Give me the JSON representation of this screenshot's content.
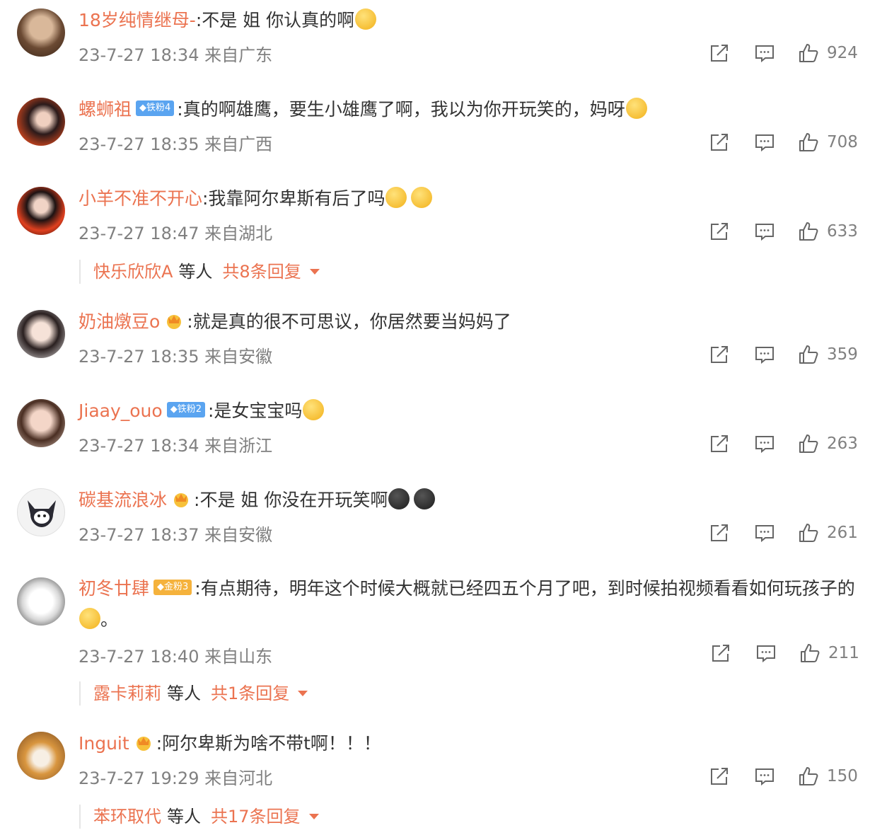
{
  "comments": [
    {
      "nick": "18岁纯情继母-",
      "badge": "",
      "text": ":不是 姐 你认真的啊",
      "time": "23-7-27 18:34 来自广东",
      "likes": "924"
    },
    {
      "nick": "螺蛳祖",
      "badge": "铁粉4",
      "text": ":真的啊雄鹰，要生小雄鹰了啊，我以为你开玩笑的，妈呀",
      "time": "23-7-27 18:35 来自广西",
      "likes": "708"
    },
    {
      "nick": "小羊不准不开心",
      "badge": "",
      "text": ":我靠阿尔卑斯有后了吗",
      "time": "23-7-27 18:47 来自湖北",
      "likes": "633"
    },
    {
      "nick": "奶油燉豆o",
      "badge": "",
      "text": ":就是真的很不可思议，你居然要当妈妈了",
      "time": "23-7-27 18:35 来自安徽",
      "likes": "359"
    },
    {
      "nick": "Jiaay_ouo",
      "badge": "铁粉2",
      "text": ":是女宝宝吗",
      "time": "23-7-27 18:34 来自浙江",
      "likes": "263"
    },
    {
      "nick": "碳基流浪冰",
      "badge": "",
      "text": ":不是 姐 你没在开玩笑啊",
      "time": "23-7-27 18:37 来自安徽",
      "likes": "261"
    },
    {
      "nick": "初冬廿肆",
      "badge": "金粉3",
      "text": ":有点期待，明年这个时候大概就已经四五个月了吧，到时候拍视频看看如何玩孩子的",
      "text_end": "。",
      "time": "23-7-27 18:40 来自山东",
      "likes": "211"
    },
    {
      "nick": "Inguit",
      "badge": "",
      "text": ":阿尔卑斯为啥不带t啊！！！",
      "time": "23-7-27 19:29 来自河北",
      "likes": "150"
    }
  ],
  "replies": [
    {
      "name": "快乐欣欣A",
      "etc": "等人",
      "total": "共8条回复"
    },
    {
      "name": "露卡莉莉",
      "etc": "等人",
      "total": "共1条回复"
    },
    {
      "name": "苯环取代",
      "etc": "等人",
      "total": "共17条回复"
    }
  ],
  "icons": [
    "share-icon",
    "comment-icon",
    "like-icon",
    "crown-icon",
    "caret-down-icon"
  ],
  "colors": {
    "nickname": "#eb7350",
    "meta": "#808080",
    "badge_blue": "#5aa4f0",
    "badge_gold": "#f5b23c"
  }
}
